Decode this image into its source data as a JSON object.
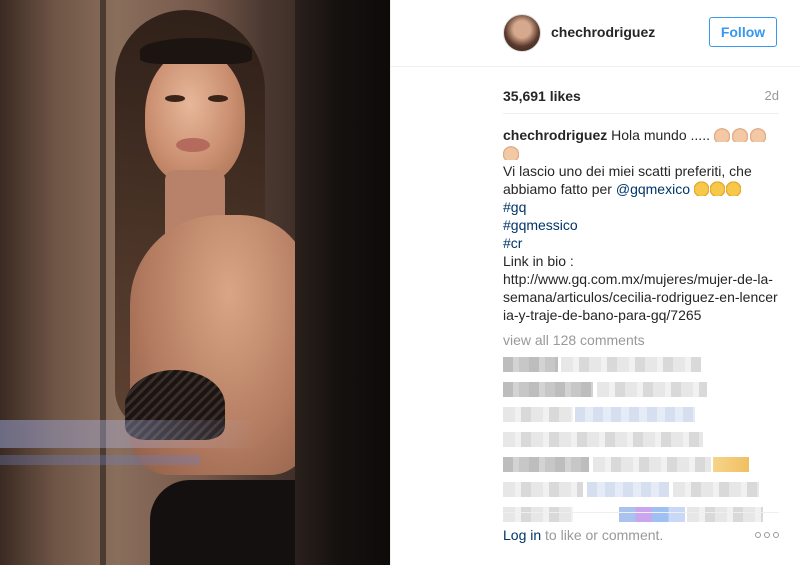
{
  "post": {
    "username": "chechrodriguez",
    "follow_label": "Follow",
    "likes": "35,691 likes",
    "age": "2d",
    "caption": {
      "username": "chechrodriguez",
      "line1": "Hola mundo .....",
      "line2": "Vi lascio uno dei miei scatti preferiti, che abbiamo fatto per",
      "mention": "@gqmexico",
      "tag1": "#gq",
      "tag2": "#gqmessico",
      "tag3": "#cr",
      "link_label": "Link in bio :",
      "url": "http://www.gq.com.mx/mujeres/mujer-de-la-semana/articulos/cecilia-rodriguez-en-lenceria-y-traje-de-bano-para-gq/7265"
    },
    "view_all_comments": "view all 128 comments",
    "footer": {
      "login_link": "Log in",
      "login_rest": " to like or comment."
    }
  },
  "icons": {
    "raising_hands": "raising-hands-emoji",
    "thumbs_up": "thumbs-up-emoji",
    "more": "more-options-icon"
  },
  "colors": {
    "accent": "#3897f0",
    "link": "#003569",
    "muted": "#999999",
    "text": "#262626"
  }
}
